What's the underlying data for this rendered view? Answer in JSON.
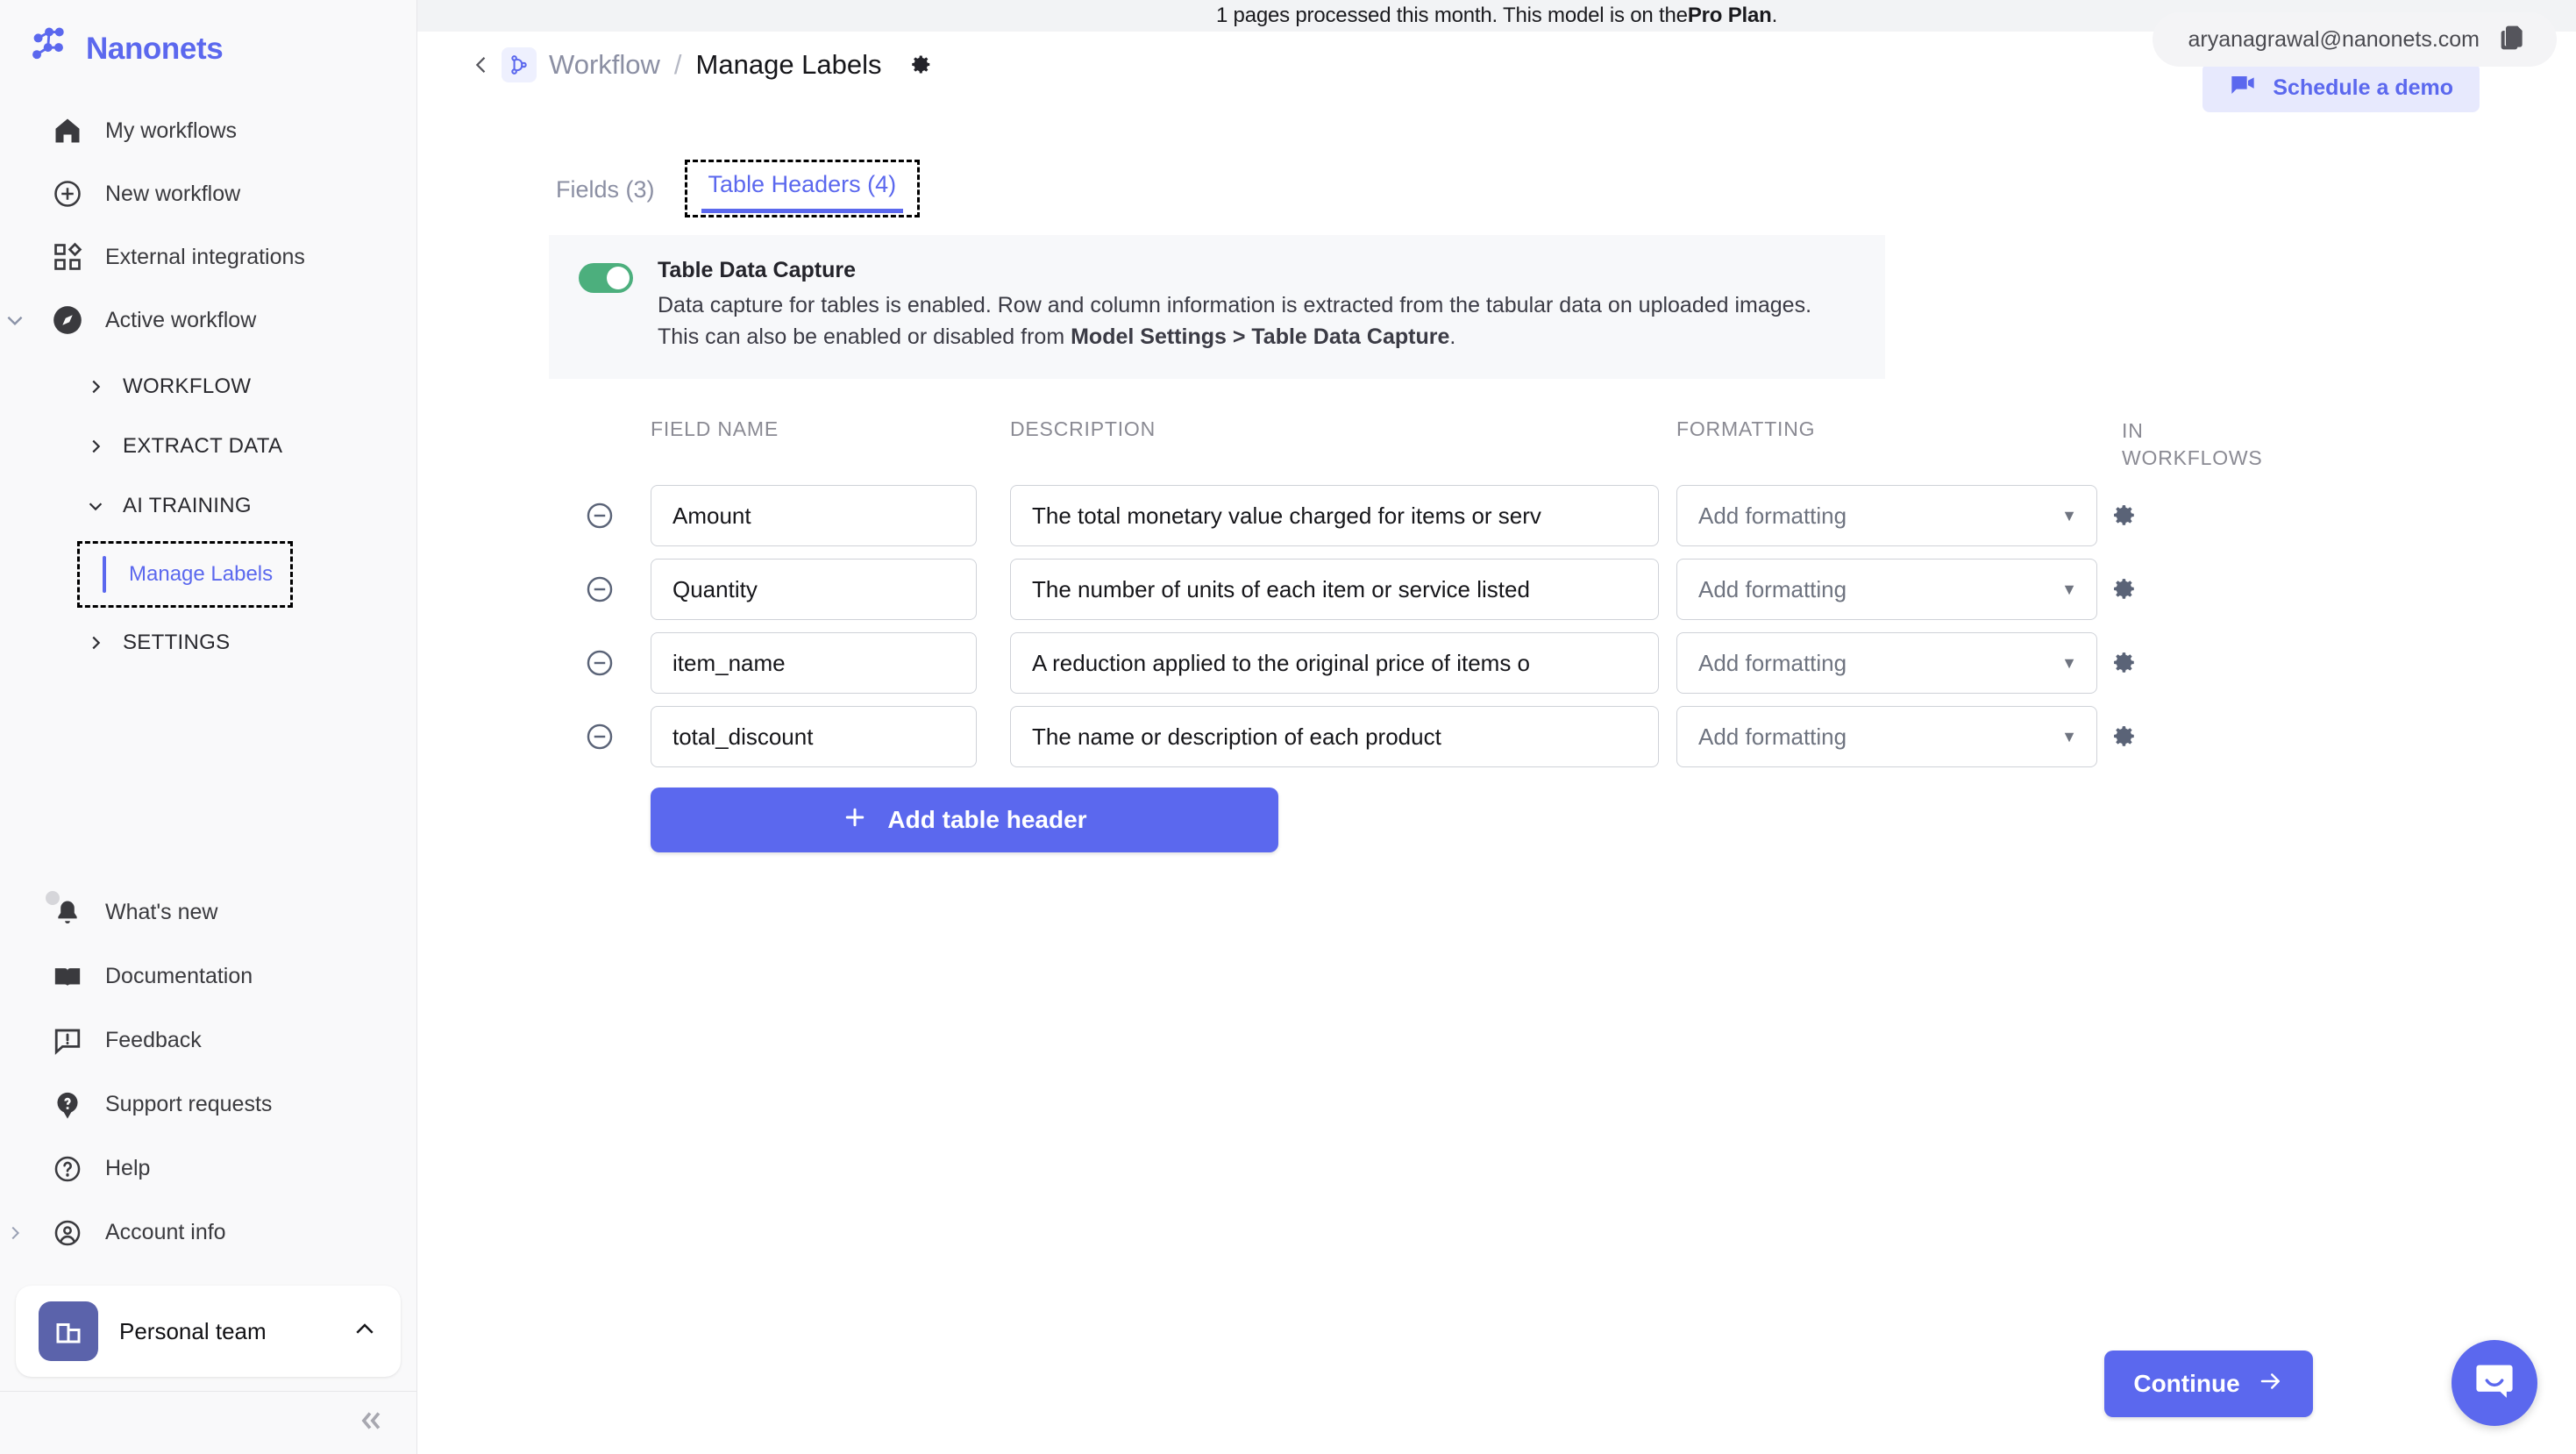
{
  "top_banner": {
    "text_before": "1 pages processed this month. This model is on the ",
    "plan": "Pro Plan",
    "text_after": "."
  },
  "account": {
    "email": "aryanagrawal@nanonets.com",
    "copy_icon": "copy-icon",
    "demo_label": "Schedule a demo",
    "demo_icon": "video-camera-icon"
  },
  "sidebar": {
    "brand": "Nanonets",
    "brand_icon": "nanonets-logo-icon",
    "nav": [
      {
        "label": "My workflows",
        "icon": "home-icon"
      },
      {
        "label": "New workflow",
        "icon": "plus-circle-icon"
      },
      {
        "label": "External integrations",
        "icon": "grid-apps-icon"
      },
      {
        "label": "Active workflow",
        "icon": "compass-icon",
        "caret": "chevron-down-icon"
      }
    ],
    "tree": [
      {
        "label": "WORKFLOW",
        "caret": "chevron-right-icon"
      },
      {
        "label": "EXTRACT DATA",
        "caret": "chevron-right-icon"
      },
      {
        "label": "AI TRAINING",
        "caret": "chevron-down-icon"
      }
    ],
    "tree_child": {
      "label": "Manage Labels"
    },
    "tree_last": {
      "label": "SETTINGS",
      "caret": "chevron-right-icon"
    },
    "bottom": [
      {
        "label": "What's new",
        "icon": "bell-icon"
      },
      {
        "label": "Documentation",
        "icon": "book-icon"
      },
      {
        "label": "Feedback",
        "icon": "feedback-chat-icon"
      },
      {
        "label": "Support requests",
        "icon": "question-pin-icon"
      },
      {
        "label": "Help",
        "icon": "help-circle-icon"
      },
      {
        "label": "Account info",
        "icon": "user-circle-icon",
        "caret": "chevron-right-icon"
      }
    ],
    "team": {
      "name": "Personal team",
      "icon": "building-icon",
      "caret": "chevron-up-icon"
    },
    "collapse_icon": "double-chevron-left-icon"
  },
  "header": {
    "back_icon": "chevron-left-icon",
    "workflow_icon": "workflow-branch-icon",
    "crumb_parent": "Workflow",
    "crumb_separator": "/",
    "crumb_current": "Manage Labels",
    "gear_icon": "gear-icon"
  },
  "tabs": [
    {
      "label": "Fields (3)",
      "active": false
    },
    {
      "label": "Table Headers (4)",
      "active": true
    }
  ],
  "notice": {
    "title": "Table Data Capture",
    "line1": "Data capture for tables is enabled. Row and column information is extracted from the tabular data on uploaded images.",
    "line2_prefix": "This can also be enabled or disabled from ",
    "line2_bold": "Model Settings > Table Data Capture",
    "line2_suffix": ".",
    "toggle_on": true,
    "toggle_color": "#4caf7d"
  },
  "table": {
    "columns": {
      "field_name": "FIELD NAME",
      "description": "DESCRIPTION",
      "formatting": "FORMATTING",
      "in_workflows_line1": "IN",
      "in_workflows_line2": "WORKFLOWS"
    },
    "rows": [
      {
        "remove_icon": "minus-circle-icon",
        "field_name": "Amount",
        "description": "The total monetary value charged for items or serv",
        "formatting": "Add formatting",
        "formatting_chevron": "chevron-down-icon",
        "workflow_icon": "gear-icon"
      },
      {
        "remove_icon": "minus-circle-icon",
        "field_name": "Quantity",
        "description": "The number of units of each item or service listed",
        "formatting": "Add formatting",
        "formatting_chevron": "chevron-down-icon",
        "workflow_icon": "gear-icon"
      },
      {
        "remove_icon": "minus-circle-icon",
        "field_name": "item_name",
        "description": "A reduction applied to the original price of items o",
        "formatting": "Add formatting",
        "formatting_chevron": "chevron-down-icon",
        "workflow_icon": "gear-icon"
      },
      {
        "remove_icon": "minus-circle-icon",
        "field_name": "total_discount",
        "description": "The name or description of each product",
        "formatting": "Add formatting",
        "formatting_chevron": "chevron-down-icon",
        "workflow_icon": "gear-icon"
      }
    ],
    "add_button": {
      "label": "Add table header",
      "icon": "plus-icon"
    }
  },
  "footer": {
    "continue_label": "Continue",
    "continue_icon": "arrow-right-icon",
    "chat_icon": "chat-bubble-icon"
  },
  "colors": {
    "accent": "#5b68ee",
    "toggle_green": "#4caf7d",
    "sidebar_bg": "#f9f9fa",
    "banner_bg": "#f2f3f5"
  }
}
